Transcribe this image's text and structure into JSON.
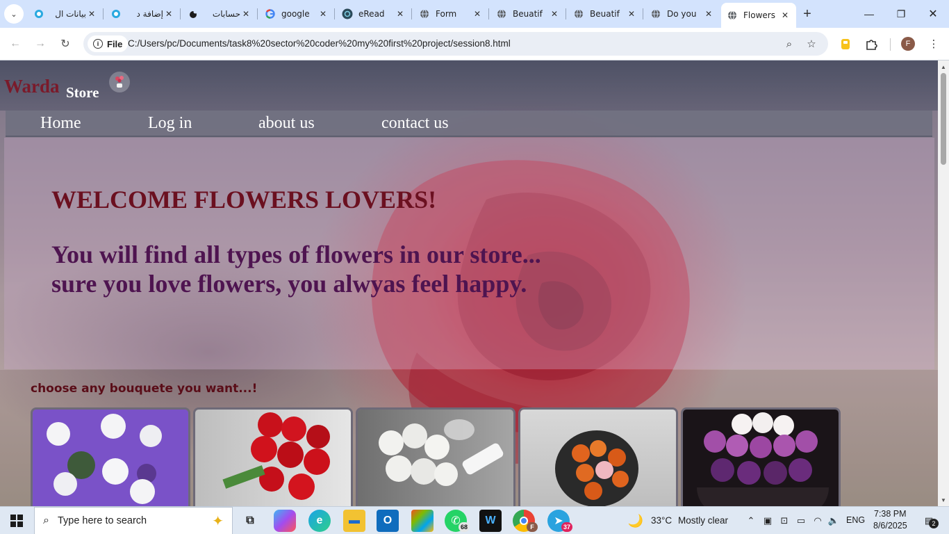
{
  "browser": {
    "tabs": [
      {
        "title": "بيانات ال",
        "favicon": "circle-blue"
      },
      {
        "title": "إضافة د",
        "favicon": "circle-blue"
      },
      {
        "title": "حسابات",
        "favicon": "moon-dark"
      },
      {
        "title": "google",
        "favicon": "google-g"
      },
      {
        "title": "eRead",
        "favicon": "eread"
      },
      {
        "title": "Form",
        "favicon": "globe"
      },
      {
        "title": "Beuatif",
        "favicon": "globe"
      },
      {
        "title": "Beuatif",
        "favicon": "globe"
      },
      {
        "title": "Do you",
        "favicon": "globe"
      },
      {
        "title": "Flowers",
        "favicon": "globe"
      }
    ],
    "active_tab_index": 9,
    "file_label": "File",
    "url": "C:/Users/pc/Documents/task8%20sector%20coder%20my%20first%20project/session8.html",
    "profile_initial": "F"
  },
  "site": {
    "logo_primary": "Warda",
    "logo_secondary": "Store",
    "nav": [
      "Home",
      "Log in",
      "about us",
      "contact us"
    ],
    "hero_title": "WELCOME FLOWERS LOVERS!",
    "hero_line1": "You will find all types of flowers in our store...",
    "hero_line2": "sure you love flowers, you alwyas feel happy.",
    "choose_heading": "choose any bouquete you want...!",
    "bouquets": [
      {
        "name": "white-purple-bouquet",
        "colors": [
          "#7a52c8",
          "#f4f4f6",
          "#3e5a3a"
        ]
      },
      {
        "name": "red-rose-bouquet",
        "colors": [
          "#d9d9d9",
          "#c8111b",
          "#4a8a3a"
        ]
      },
      {
        "name": "white-rose-bouquet",
        "colors": [
          "#8a8a8a",
          "#f2f2ef",
          "#dadada"
        ]
      },
      {
        "name": "orange-rose-bouquet",
        "colors": [
          "#cfcfcf",
          "#e0641e",
          "#2a2a2a"
        ]
      },
      {
        "name": "purple-rose-box",
        "colors": [
          "#1a1418",
          "#a24fa8",
          "#f6f2f2"
        ]
      }
    ]
  },
  "taskbar": {
    "search_placeholder": "Type here to search",
    "whatsapp_badge": "68",
    "telegram_badge": "37",
    "chrome_badge": "F",
    "weather_temp": "33°C",
    "weather_desc": "Mostly clear",
    "language": "ENG",
    "time": "7:38 PM",
    "date": "8/6/2025",
    "notification_count": "2"
  }
}
